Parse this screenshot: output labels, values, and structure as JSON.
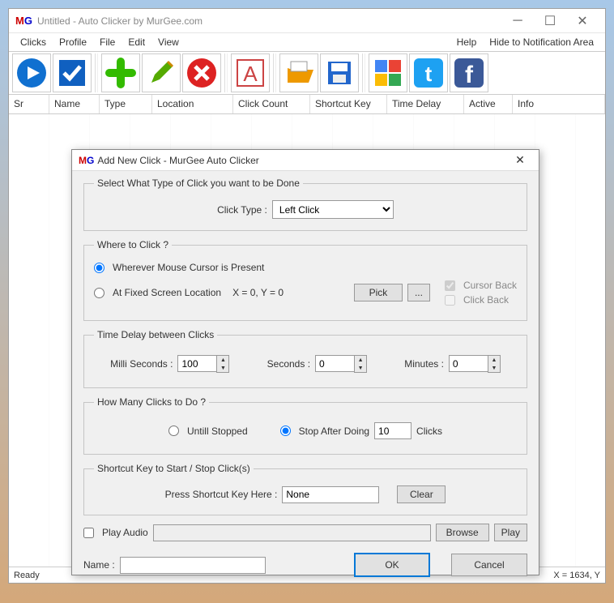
{
  "main": {
    "title": "Untitled - Auto Clicker by MurGee.com",
    "menu": {
      "clicks": "Clicks",
      "profile": "Profile",
      "file": "File",
      "edit": "Edit",
      "view": "View",
      "help": "Help",
      "hide": "Hide to Notification Area"
    },
    "columns": {
      "sr": "Sr",
      "name": "Name",
      "type": "Type",
      "location": "Location",
      "clickcount": "Click Count",
      "shortcut": "Shortcut Key",
      "timedelay": "Time Delay",
      "active": "Active",
      "info": "Info"
    },
    "status": {
      "ready": "Ready",
      "coords": "X = 1634, Y"
    }
  },
  "dialog": {
    "title": "Add New Click - MurGee Auto Clicker",
    "type_group": "Select What Type of Click you want to be Done",
    "click_type_label": "Click Type :",
    "click_type_value": "Left Click",
    "where_group": "Where to Click ?",
    "where_radio1": "Wherever Mouse Cursor is Present",
    "where_radio2": "At Fixed Screen Location",
    "where_coords": "X = 0, Y = 0",
    "pick": "Pick",
    "dots": "...",
    "cursor_back": "Cursor Back",
    "click_back": "Click Back",
    "delay_group": "Time Delay between Clicks",
    "ms_label": "Milli Seconds :",
    "ms_value": "100",
    "sec_label": "Seconds :",
    "sec_value": "0",
    "min_label": "Minutes :",
    "min_value": "0",
    "howmany_group": "How Many Clicks to Do ?",
    "untill": "Untill Stopped",
    "stop_after": "Stop After Doing",
    "stop_count": "10",
    "clicks_suffix": "Clicks",
    "shortcut_group": "Shortcut Key to Start / Stop Click(s)",
    "press_label": "Press Shortcut Key Here :",
    "shortcut_value": "None",
    "clear": "Clear",
    "play_audio": "Play Audio",
    "browse": "Browse",
    "play": "Play",
    "name_label": "Name :",
    "ok": "OK",
    "cancel": "Cancel"
  }
}
